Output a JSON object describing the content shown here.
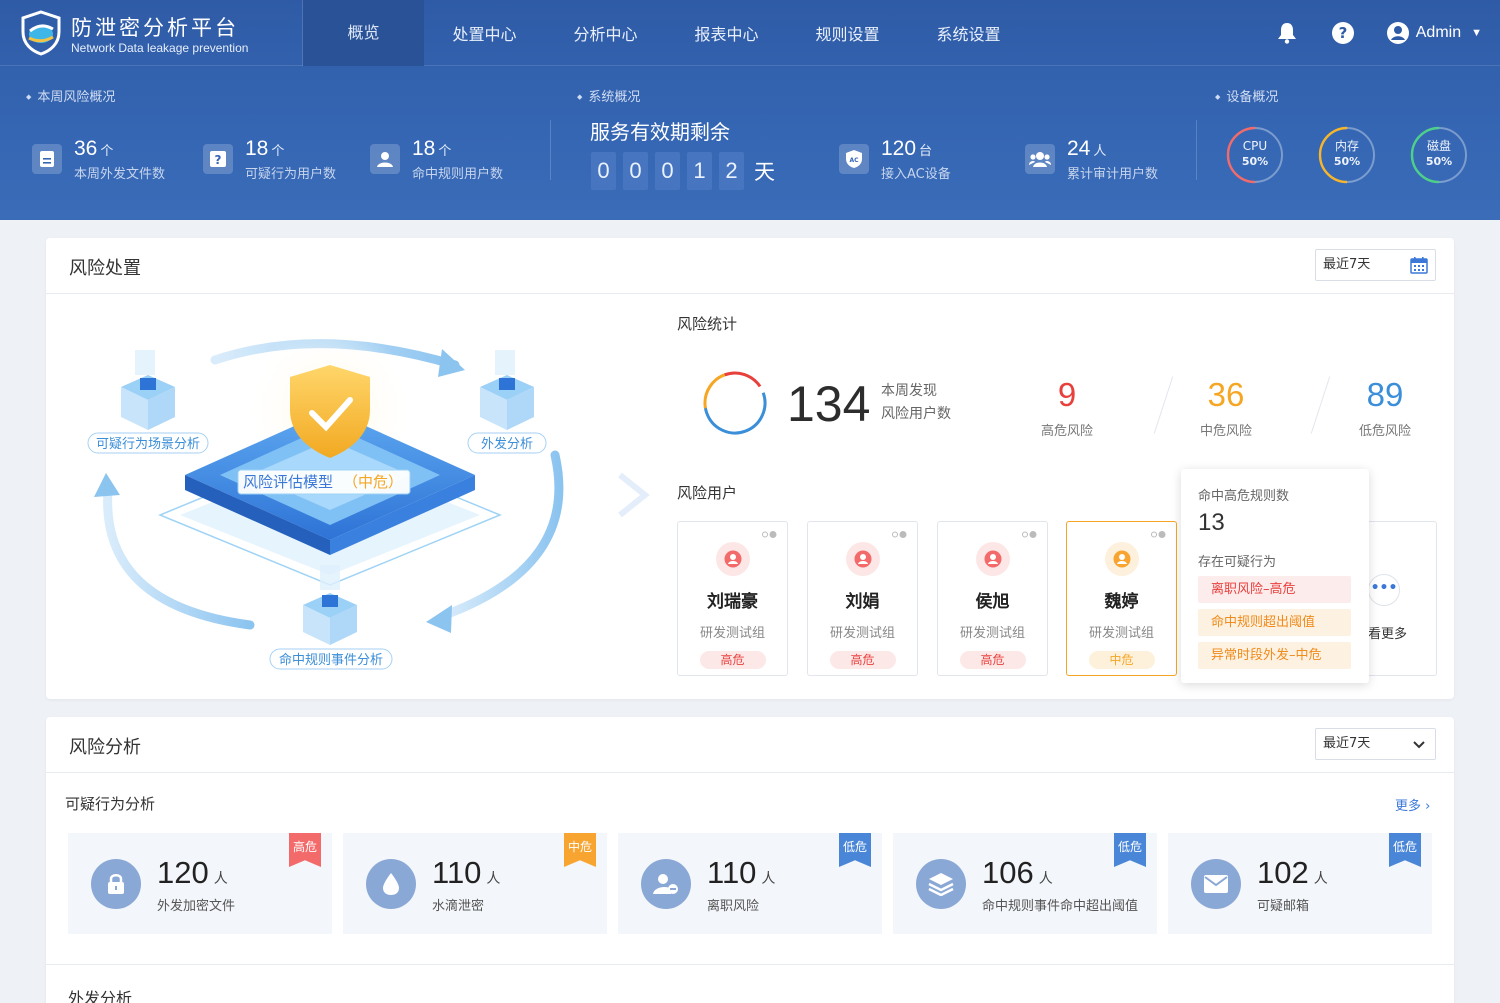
{
  "brand": {
    "title": "防泄密分析平台",
    "subtitle": "Network Data leakage prevention"
  },
  "nav": {
    "items": [
      "概览",
      "处置中心",
      "分析中心",
      "报表中心",
      "规则设置",
      "系统设置"
    ],
    "active": "概览",
    "user": "Admin",
    "icons": [
      "bell-icon",
      "help-icon",
      "user-icon"
    ]
  },
  "overview": {
    "weekly_label": "本周风险概况",
    "weekly": [
      {
        "num": "36",
        "unit": "个",
        "desc": "本周外发文件数",
        "icon": "file-icon"
      },
      {
        "num": "18",
        "unit": "个",
        "desc": "可疑行为用户数",
        "icon": "question-icon"
      },
      {
        "num": "18",
        "unit": "个",
        "desc": "命中规则用户数",
        "icon": "user-icon"
      }
    ],
    "system_label": "系统概况",
    "service_title": "服务有效期剩余",
    "service_digits": [
      "0",
      "0",
      "0",
      "1",
      "2"
    ],
    "service_unit": "天",
    "system": [
      {
        "num": "120",
        "unit": "台",
        "desc": "接入AC设备",
        "icon": "ac-shield-icon"
      },
      {
        "num": "24",
        "unit": "人",
        "desc": "累计审计用户数",
        "icon": "users-icon"
      }
    ],
    "device_label": "设备概况",
    "devices": [
      {
        "name": "CPU",
        "value": "50%",
        "percent": 50,
        "color": "#f36a6a"
      },
      {
        "name": "内存",
        "value": "50%",
        "percent": 50,
        "color": "#f7b52c"
      },
      {
        "name": "磁盘",
        "value": "50%",
        "percent": 50,
        "color": "#4fd08a"
      }
    ]
  },
  "risk_handling": {
    "title": "风险处置",
    "range": "最近7天",
    "diagram": {
      "center": "风险评估模型",
      "center_level": "（中危）",
      "nodes": [
        "可疑行为场景分析",
        "外发分析",
        "命中规则事件分析"
      ]
    },
    "stats_title": "风险统计",
    "total": "134",
    "total_desc": [
      "本周发现",
      "风险用户数"
    ],
    "levels": [
      {
        "num": "9",
        "label": "高危风险",
        "color": "#e8403d"
      },
      {
        "num": "36",
        "label": "中危风险",
        "color": "#f5a623"
      },
      {
        "num": "89",
        "label": "低危风险",
        "color": "#3b8ed8"
      }
    ],
    "users_title": "风险用户",
    "users": [
      {
        "name": "刘瑞豪",
        "group": "研发测试组",
        "level": "高危",
        "type": "high"
      },
      {
        "name": "刘娟",
        "group": "研发测试组",
        "level": "高危",
        "type": "high"
      },
      {
        "name": "侯旭",
        "group": "研发测试组",
        "level": "高危",
        "type": "high"
      },
      {
        "name": "魏婷",
        "group": "研发测试组",
        "level": "中危",
        "type": "mid"
      }
    ],
    "more_users": "看更多",
    "popover": {
      "rule_label": "命中高危规则数",
      "rule_count": "13",
      "behavior_label": "存在可疑行为",
      "tags": [
        {
          "text": "离职风险–高危",
          "type": "red"
        },
        {
          "text": "命中规则超出阈值",
          "type": "org"
        },
        {
          "text": "异常时段外发–中危",
          "type": "org"
        }
      ]
    }
  },
  "risk_analysis": {
    "title": "风险分析",
    "range": "最近7天",
    "suspicious_title": "可疑行为分析",
    "more": "更多",
    "cards": [
      {
        "num": "120",
        "unit": "人",
        "desc": "外发加密文件",
        "level": "高危",
        "type": "high",
        "icon": "lock-icon"
      },
      {
        "num": "110",
        "unit": "人",
        "desc": "水滴泄密",
        "level": "中危",
        "type": "mid",
        "icon": "drop-icon"
      },
      {
        "num": "110",
        "unit": "人",
        "desc": "离职风险",
        "level": "低危",
        "type": "low",
        "icon": "user-leave-icon"
      },
      {
        "num": "106",
        "unit": "人",
        "desc": "命中规则事件命中超出阈值",
        "level": "低危",
        "type": "low",
        "icon": "layers-icon"
      },
      {
        "num": "102",
        "unit": "人",
        "desc": "可疑邮箱",
        "level": "低危",
        "type": "low",
        "icon": "mail-icon"
      }
    ],
    "outbound_title": "外发分析"
  }
}
